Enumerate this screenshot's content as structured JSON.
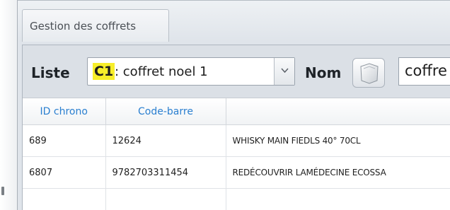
{
  "window": {
    "title": "Gestion des coffrets"
  },
  "toolbar": {
    "liste_label": "Liste",
    "liste_select": {
      "code": "C1",
      "text": " : coffret noel 1"
    },
    "nom_label": "Nom",
    "nom_value": "coffre"
  },
  "grid": {
    "columns": [
      "ID chrono",
      "Code-barre",
      ""
    ],
    "rows": [
      {
        "id": "689",
        "barcode": "12624",
        "designation": "WHISKY MAIN FIEDLS 40° 70CL"
      },
      {
        "id": "6807",
        "barcode": "9782703311454",
        "designation": "REDÉCOUVRIR LAMÉDECINE ECOSSA"
      }
    ]
  },
  "colors": {
    "highlight": "#f7ee2a",
    "header_text": "#2a7fd0",
    "window_bg": "#dfe4ea"
  },
  "icons": {
    "combo_arrow": "chevron-down-icon",
    "nom_button": "document-icon"
  }
}
